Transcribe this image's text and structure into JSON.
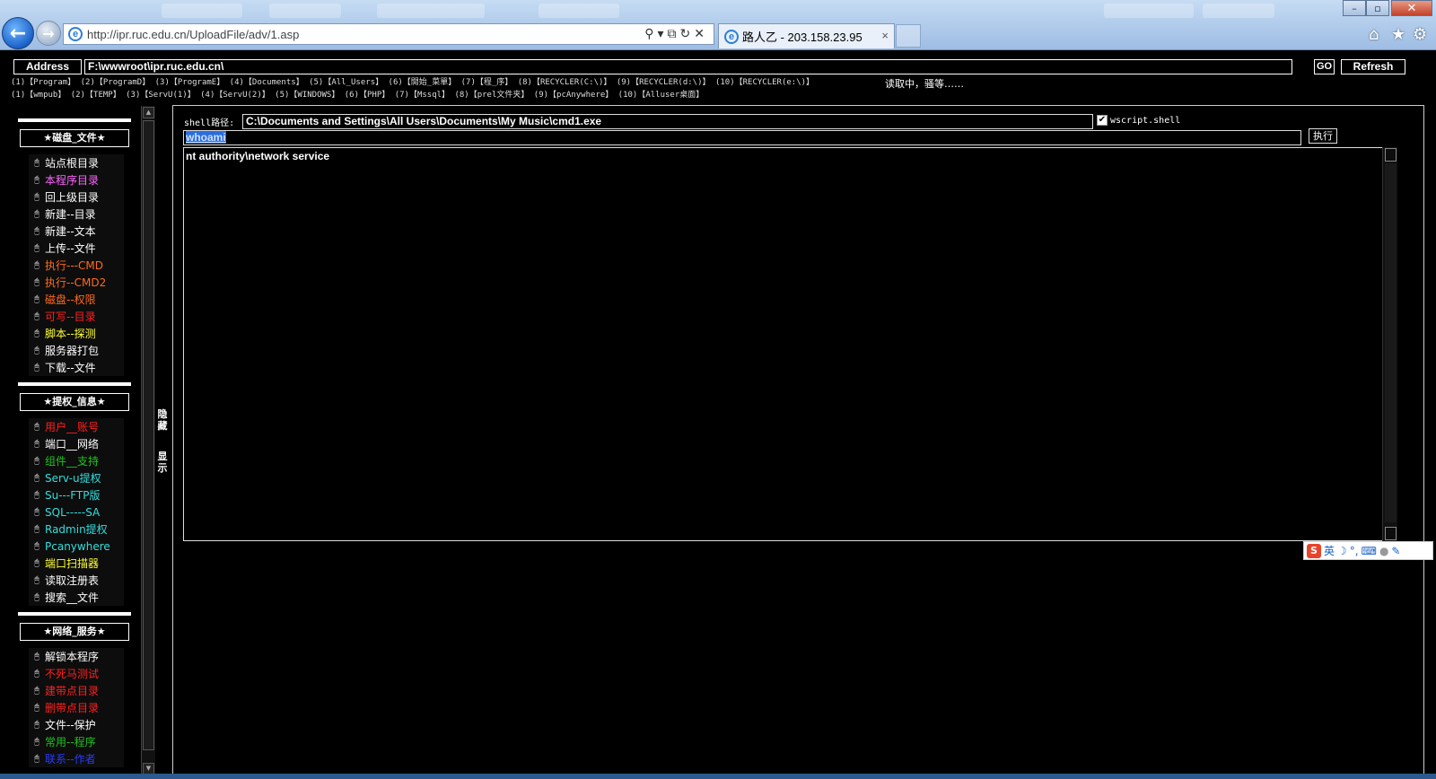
{
  "browser": {
    "url": "http://ipr.ruc.edu.cn/UploadFile/adv/1.asp",
    "tab_title": "路人乙 - 203.158.23.95",
    "tab_close": "×",
    "back_glyph": "←",
    "forward_glyph": "→",
    "icons": [
      "home-icon",
      "favorites-star-icon",
      "tools-gear-icon"
    ],
    "window_buttons": {
      "minimize": "–",
      "maximize": "▫",
      "close": "✕"
    }
  },
  "address": {
    "label": "Address",
    "value": "F:\\wwwroot\\ipr.ruc.edu.cn\\",
    "go_label": "GO",
    "refresh_label": "Refresh"
  },
  "quick_links": {
    "row1": "(1)【Program】 (2)【ProgramD】 (3)【ProgramE】 (4)【Documents】 (5)【All_Users】 (6)【開始_菜單】 (7)【程_序】 (8)【RECYCLER(C:\\)】 (9)【RECYCLER(d:\\)】 (10)【RECYCLER(e:\\)】",
    "row2": "(1)【wmpub】  (2)【TEMP】     (3)【ServU(1)】 (4)【ServU(2)】 (5)【WINDOWS】  (6)【PHP】       (7)【Mssql】 (8)【prel文件夹】   (9)【pcAnywhere】 (10)【Alluser桌面】",
    "loading": "读取中，骚等……"
  },
  "sidebar": {
    "groups": [
      {
        "title": "★磁盘_文件★",
        "items": [
          {
            "label": "站点根目录",
            "color": "#ffffff"
          },
          {
            "label": "本程序目录",
            "color": "#ff66ff"
          },
          {
            "label": "回上级目录",
            "color": "#ffffff"
          },
          {
            "label": "新建--目录",
            "color": "#ffffff"
          },
          {
            "label": "新建--文本",
            "color": "#ffffff"
          },
          {
            "label": "上传--文件",
            "color": "#ffffff"
          },
          {
            "label": "执行---CMD",
            "color": "#ff6a1a"
          },
          {
            "label": "执行--CMD2",
            "color": "#ff6a1a"
          },
          {
            "label": "磁盘--权限",
            "color": "#ff6a1a"
          },
          {
            "label": "可写--目录",
            "color": "#ff2020"
          },
          {
            "label": "脚本--探测",
            "color": "#ffff33"
          },
          {
            "label": "服务器打包",
            "color": "#ffffff"
          },
          {
            "label": "下载--文件",
            "color": "#ffffff"
          }
        ]
      },
      {
        "title": "★提权_信息★",
        "items": [
          {
            "label": "用户__账号",
            "color": "#ff2020"
          },
          {
            "label": "端口__网络",
            "color": "#ffffff"
          },
          {
            "label": "组件__支持",
            "color": "#22c022"
          },
          {
            "label": "Serv-u提权",
            "color": "#33dddd"
          },
          {
            "label": "Su---FTP版",
            "color": "#33dddd"
          },
          {
            "label": "SQL-----SA",
            "color": "#33dddd"
          },
          {
            "label": "Radmin提权",
            "color": "#33dddd"
          },
          {
            "label": "Pcanywhere",
            "color": "#33dddd"
          },
          {
            "label": "端口扫描器",
            "color": "#ffff33"
          },
          {
            "label": "读取注册表",
            "color": "#ffffff"
          },
          {
            "label": "搜索__文件",
            "color": "#ffffff"
          }
        ]
      },
      {
        "title": "★网络_服务★",
        "items": [
          {
            "label": "解锁本程序",
            "color": "#ffffff"
          },
          {
            "label": "不死马测试",
            "color": "#ff2020"
          },
          {
            "label": "建带点目录",
            "color": "#ff2020"
          },
          {
            "label": "删带点目录",
            "color": "#ff2020"
          },
          {
            "label": "文件--保护",
            "color": "#ffffff"
          },
          {
            "label": "常用--程序",
            "color": "#22c022"
          },
          {
            "label": "联系--作者",
            "color": "#2a3cff"
          }
        ]
      }
    ],
    "toggle_hide": "隐\n藏",
    "toggle_show": "显\n示"
  },
  "shell": {
    "path_label": "shell路径:",
    "path_value": "C:\\Documents and Settings\\All Users\\Documents\\My Music\\cmd1.exe",
    "wscript_checked": true,
    "wscript_label": "wscript.shell",
    "command": "whoami",
    "exec_label": "执行",
    "output": "nt authority\\network service"
  },
  "ime": {
    "logo": "S",
    "lang": "英",
    "icons": [
      "moon-icon",
      "punctuation-icon",
      "keyboard-icon",
      "user-icon",
      "wrench-icon"
    ]
  }
}
